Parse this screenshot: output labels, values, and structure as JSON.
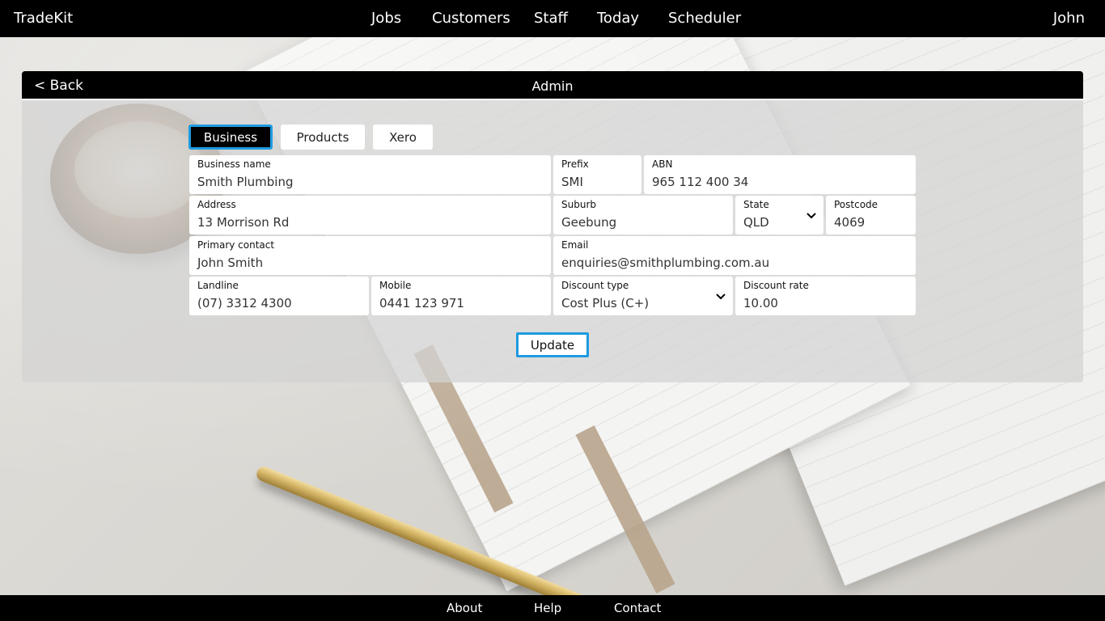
{
  "app": {
    "brand": "TradeKit",
    "user": "John"
  },
  "nav": [
    "Jobs",
    "Customers",
    "Staff",
    "Today",
    "Scheduler"
  ],
  "panel": {
    "back": "< Back",
    "title": "Admin"
  },
  "tabs": [
    {
      "label": "Business",
      "active": true
    },
    {
      "label": "Products",
      "active": false
    },
    {
      "label": "Xero",
      "active": false
    }
  ],
  "form": {
    "business_name": {
      "label": "Business name",
      "value": "Smith Plumbing"
    },
    "prefix": {
      "label": "Prefix",
      "value": "SMI"
    },
    "abn": {
      "label": "ABN",
      "value": "965 112 400 34"
    },
    "address": {
      "label": "Address",
      "value": "13 Morrison Rd"
    },
    "suburb": {
      "label": "Suburb",
      "value": "Geebung"
    },
    "state": {
      "label": "State",
      "value": "QLD"
    },
    "postcode": {
      "label": "Postcode",
      "value": "4069"
    },
    "primary_contact": {
      "label": "Primary contact",
      "value": "John Smith"
    },
    "email": {
      "label": "Email",
      "value": "enquiries@smithplumbing.com.au"
    },
    "landline": {
      "label": "Landline",
      "value": "(07) 3312 4300"
    },
    "mobile": {
      "label": "Mobile",
      "value": "0441 123 971"
    },
    "discount_type": {
      "label": "Discount type",
      "value": "Cost Plus (C+)"
    },
    "discount_rate": {
      "label": "Discount rate",
      "value": "10.00"
    }
  },
  "update_label": "Update",
  "footer": [
    "About",
    "Help",
    "Contact"
  ],
  "colors": {
    "accent": "#1e9be0",
    "nav_bg": "#000000"
  },
  "icons": {
    "select": "chevron-down-icon"
  }
}
